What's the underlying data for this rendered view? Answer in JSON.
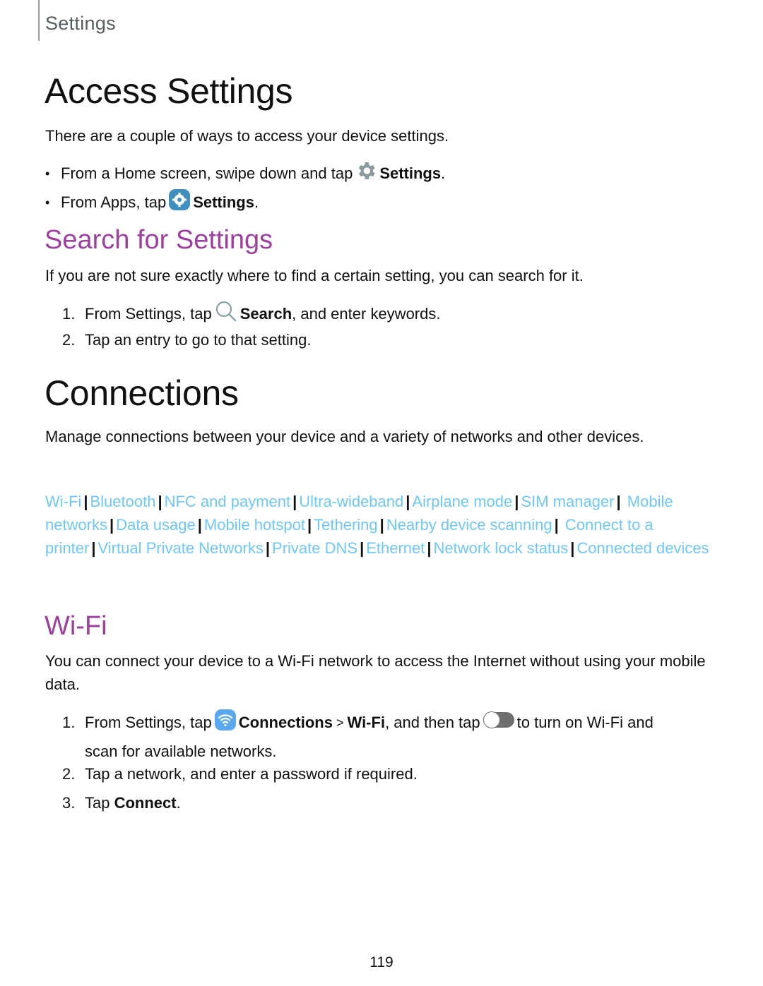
{
  "running_head": "Settings",
  "access": {
    "title": "Access Settings",
    "intro": "There are a couple of ways to access your device settings.",
    "bullets": [
      {
        "pre": "From a Home screen, swipe down and tap",
        "icon": "gear-icon",
        "bold": "Settings",
        "post": "."
      },
      {
        "pre": "From Apps, tap",
        "icon": "settings-app-icon",
        "bold": "Settings",
        "post": "."
      }
    ]
  },
  "search": {
    "title": "Search for Settings",
    "intro": "If you are not sure exactly where to find a certain setting, you can search for it.",
    "steps": [
      {
        "num": "1.",
        "pre": "From Settings, tap",
        "icon": "search-icon",
        "bold": "Search",
        "post": ", and enter keywords."
      },
      {
        "num": "2.",
        "text": "Tap an entry to go to that setting."
      }
    ]
  },
  "connections": {
    "title": "Connections",
    "intro": "Manage connections between your device and a variety of networks and other devices.",
    "links": [
      "Wi-Fi",
      "Bluetooth",
      "NFC and payment",
      "Ultra-wideband",
      "Airplane mode",
      "SIM manager",
      "Mobile networks",
      "Data usage",
      "Mobile hotspot",
      "Tethering",
      "Nearby device scanning",
      "Connect to a printer",
      "Virtual Private Networks",
      "Private DNS",
      "Ethernet",
      "Network lock status",
      "Connected devices"
    ],
    "link_color": "#6fc7f5"
  },
  "wifi": {
    "title": "Wi-Fi",
    "intro": "You can connect your device to a Wi-Fi network to access the Internet without using your mobile data.",
    "steps": [
      {
        "num": "1.",
        "pre": "From Settings, tap",
        "bold1": "Connections",
        "sep": " > ",
        "bold2": "Wi-Fi",
        "mid": ", and then tap",
        "post": "to turn on Wi-Fi and",
        "cont": "scan for available networks."
      },
      {
        "num": "2.",
        "text": "Tap a network, and enter a password if required."
      },
      {
        "num": "3.",
        "pre": "Tap ",
        "bold": "Connect",
        "post": "."
      }
    ]
  },
  "colors": {
    "heading_purple": "#9c3f9e",
    "link_blue": "#6fc7f5"
  },
  "page_number": "119"
}
